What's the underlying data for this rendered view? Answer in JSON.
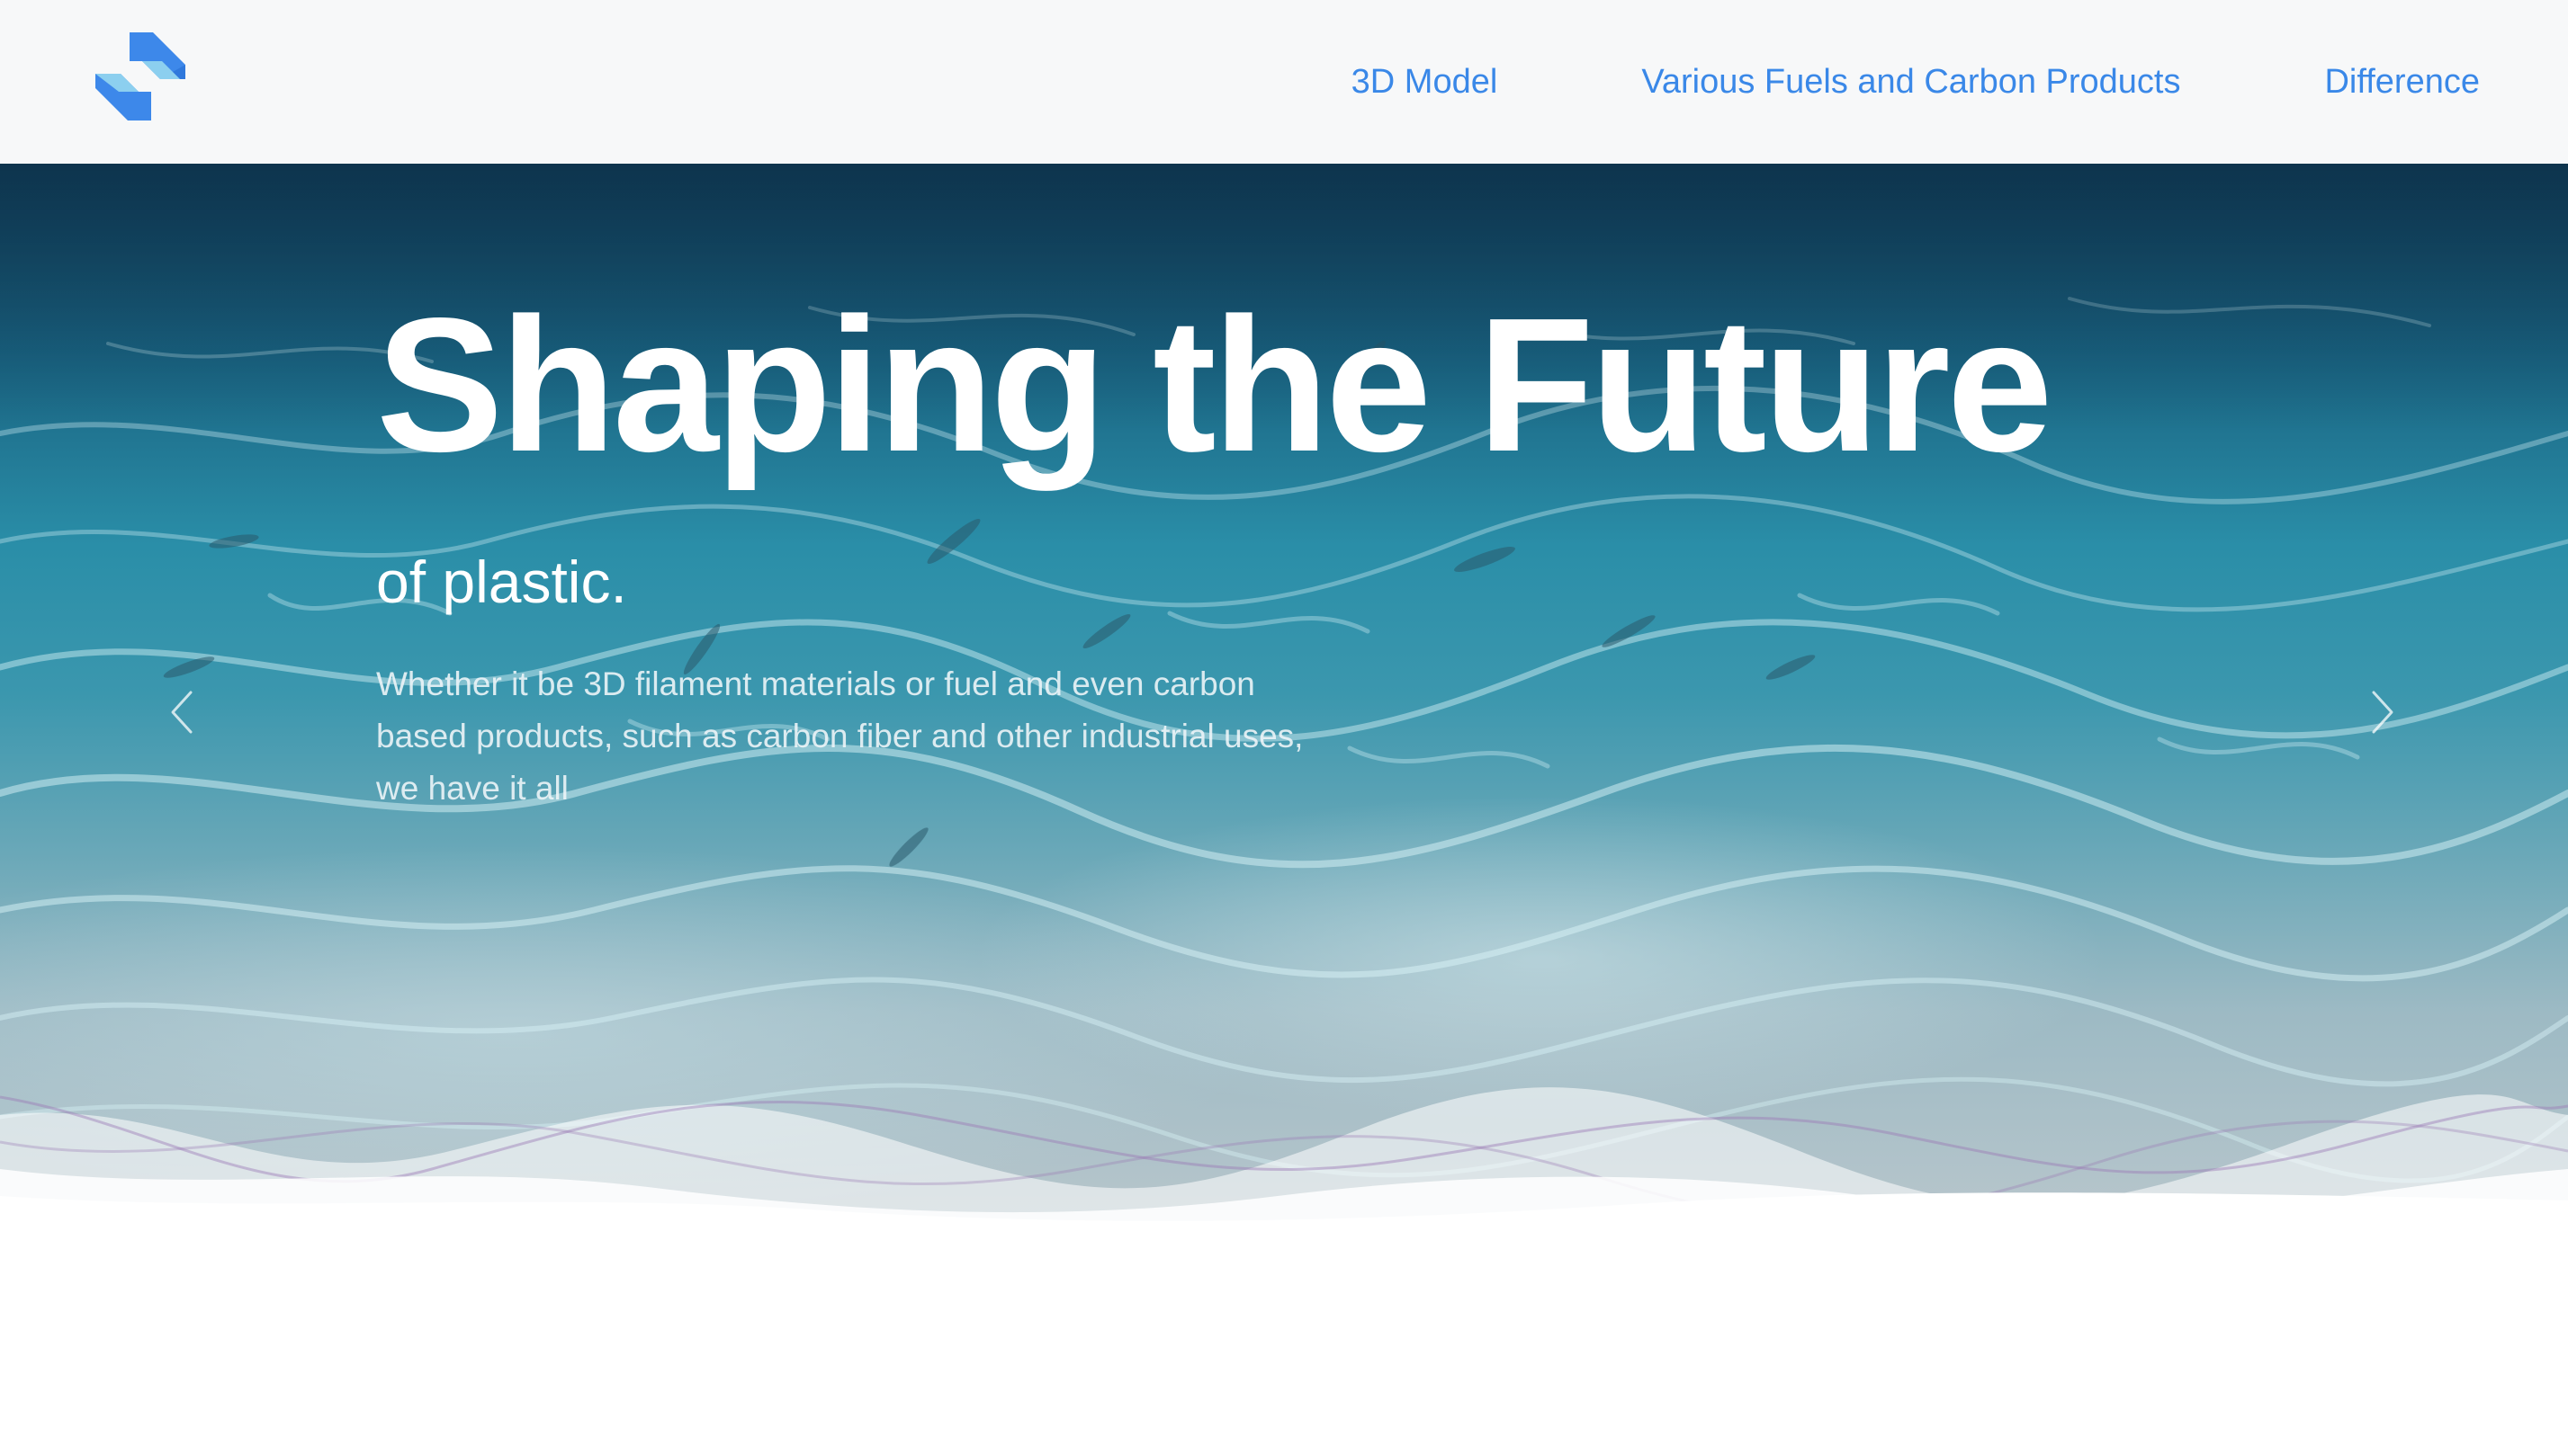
{
  "navbar": {
    "logo_icon": "brand-logo-icon",
    "links": [
      {
        "label": "3D Model"
      },
      {
        "label": "Various Fuels and Carbon Products"
      },
      {
        "label": "Difference"
      }
    ],
    "link_color": "#3a88e8",
    "background": "#f7f8f9"
  },
  "hero": {
    "title": "Shaping the Future",
    "subtitle": "of plastic.",
    "description": "Whether it be 3D filament materials or fuel and even carbon based products, such as carbon fiber and other industrial uses, we have it all",
    "prev_icon": "chevron-left-icon",
    "next_icon": "chevron-right-icon",
    "background_theme": "underwater water caustics",
    "wave_accent_color": "#9b7bb5"
  }
}
